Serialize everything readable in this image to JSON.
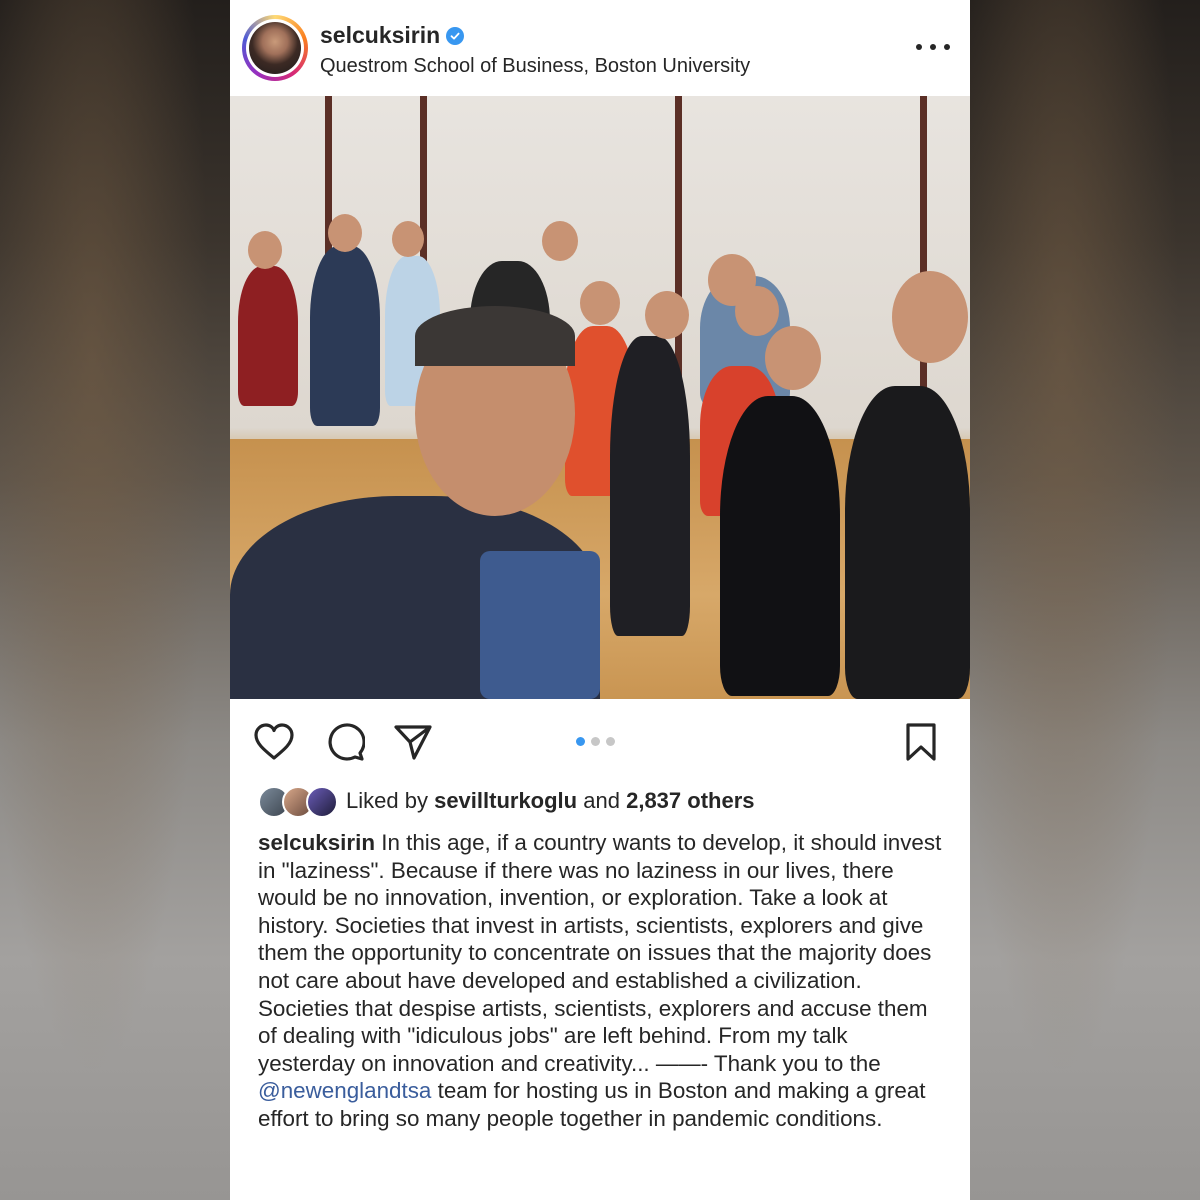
{
  "post": {
    "username": "selcuksirin",
    "location": "Questrom School of Business, Boston University",
    "likes": {
      "prefix": "Liked by",
      "liked_user": "sevillturkoglu",
      "and": "and",
      "others": "2,837 others"
    },
    "caption": {
      "user": "selcuksirin",
      "text_before_mention": " In this age, if a country wants to develop, it should invest in \"laziness\". Because if there was no laziness in our lives, there would be no innovation, invention, or exploration. Take a look at history. Societies that invest in artists, scientists, explorers and give them the opportunity to concentrate on issues that the majority does not care about have developed and established a civilization. Societies that despise artists, scientists, explorers and accuse them of dealing with \"idiculous jobs\" are left behind. From my talk yesterday on innovation and creativity... ——- Thank you to the ",
      "mention": "@newenglandtsa",
      "text_after_mention": " team for hosting us in Boston and making a great effort to bring so many people together in pandemic conditions."
    },
    "carousel": {
      "total": 3,
      "active": 1
    },
    "icons": [
      "heart-icon",
      "comment-icon",
      "share-icon",
      "bookmark-icon",
      "more-icon",
      "verified-icon"
    ],
    "colors": {
      "accent": "#3897f0",
      "text": "#262626",
      "mention": "#3a5d9c"
    }
  }
}
